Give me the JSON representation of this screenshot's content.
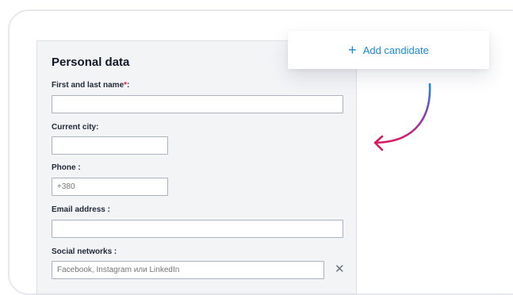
{
  "form": {
    "title": "Personal data",
    "fields": [
      {
        "label": "First and last name",
        "required_mark": "*",
        "label_suffix": ":",
        "value": "",
        "placeholder": ""
      },
      {
        "label": "Current city:",
        "value": "",
        "placeholder": ""
      },
      {
        "label": "Phone :",
        "value": "",
        "placeholder": "+380"
      },
      {
        "label": "Email address :",
        "value": "",
        "placeholder": ""
      },
      {
        "label": "Social networks :",
        "value": "",
        "placeholder": "Facebook, Instagram или LinkedIn"
      }
    ],
    "remove_symbol": "✕"
  },
  "add_candidate": {
    "icon": "plus-icon",
    "icon_glyph": "+",
    "label": "Add candidate",
    "color": "#1a8ad8"
  },
  "arrow": {
    "icon": "curved-arrow-icon",
    "gradient": [
      "#1e88e5",
      "#d81b60"
    ]
  }
}
